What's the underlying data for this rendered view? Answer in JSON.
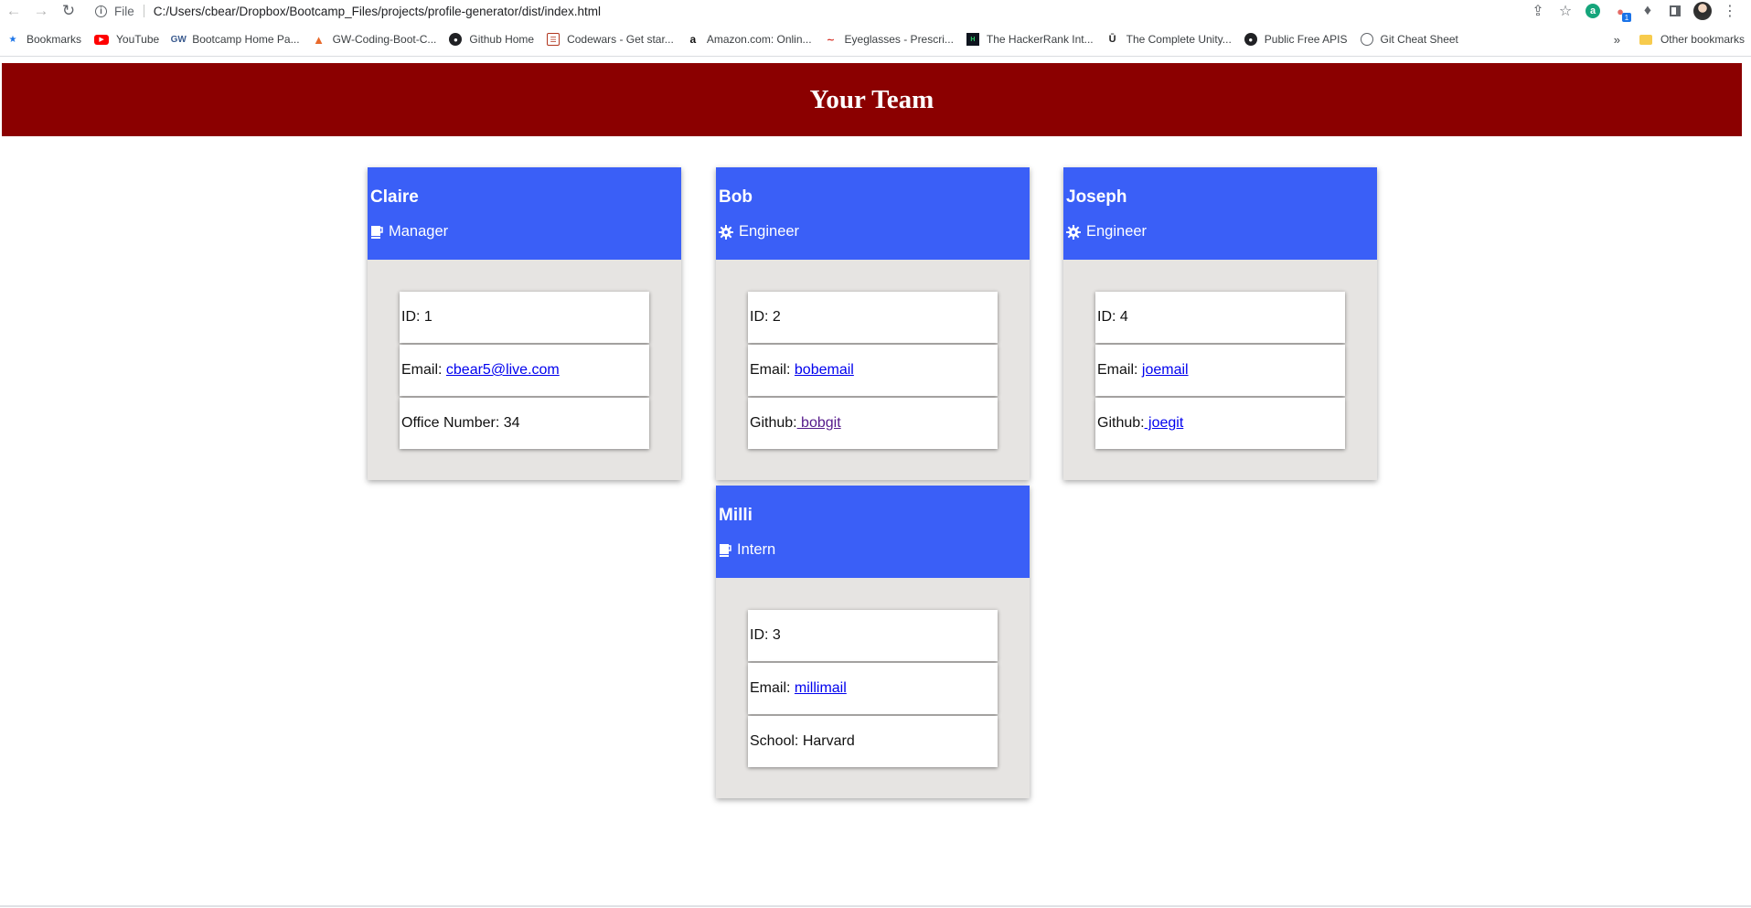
{
  "browser": {
    "scheme_label": "File",
    "url": "C:/Users/cbear/Dropbox/Bootcamp_Files/projects/profile-generator/dist/index.html",
    "extension_badge": "1",
    "bookmarks": [
      {
        "label": "Bookmarks",
        "icon": "star-icon"
      },
      {
        "label": "YouTube",
        "icon": "youtube-icon"
      },
      {
        "label": "Bootcamp Home Pa...",
        "icon": "gw-icon"
      },
      {
        "label": "GW-Coding-Boot-C...",
        "icon": "gitlab-icon"
      },
      {
        "label": "Github Home",
        "icon": "github-icon"
      },
      {
        "label": "Codewars - Get star...",
        "icon": "codewars-icon"
      },
      {
        "label": "Amazon.com: Onlin...",
        "icon": "amazon-icon"
      },
      {
        "label": "Eyeglasses - Prescri...",
        "icon": "eyeglasses-icon"
      },
      {
        "label": "The HackerRank Int...",
        "icon": "hackerrank-icon"
      },
      {
        "label": "The Complete Unity...",
        "icon": "udemy-icon"
      },
      {
        "label": "Public Free APIS",
        "icon": "github-icon"
      },
      {
        "label": "Git Cheat Sheet",
        "icon": "globe-icon"
      }
    ],
    "other_bookmarks": "Other bookmarks"
  },
  "page": {
    "title": "Your Team",
    "cards": [
      {
        "name": "Claire",
        "role": "Manager",
        "role_icon": "mug-icon",
        "id_label": "ID: 1",
        "email_prefix": "Email: ",
        "email": "cbear5@live.com",
        "extra_prefix": "Office Number: 34",
        "extra_link": ""
      },
      {
        "name": "Bob",
        "role": "Engineer",
        "role_icon": "gear-icon",
        "id_label": "ID: 2",
        "email_prefix": "Email: ",
        "email": "bobemail",
        "extra_prefix": "Github:",
        "extra_link": " bobgit"
      },
      {
        "name": "Joseph",
        "role": "Engineer",
        "role_icon": "gear-icon",
        "id_label": "ID: 4",
        "email_prefix": "Email: ",
        "email": "joemail",
        "extra_prefix": "Github:",
        "extra_link": " joegit"
      },
      {
        "name": "Milli",
        "role": "Intern",
        "role_icon": "mug-icon",
        "id_label": "ID: 3",
        "email_prefix": "Email: ",
        "email": "millimail",
        "extra_prefix": "School: Harvard",
        "extra_link": ""
      }
    ]
  },
  "colors": {
    "hero": "#8b0000",
    "card_header": "#3a5ff7",
    "card_body": "#e6e4e2",
    "link": "#0000ee",
    "visited_link": "#551a8b"
  }
}
